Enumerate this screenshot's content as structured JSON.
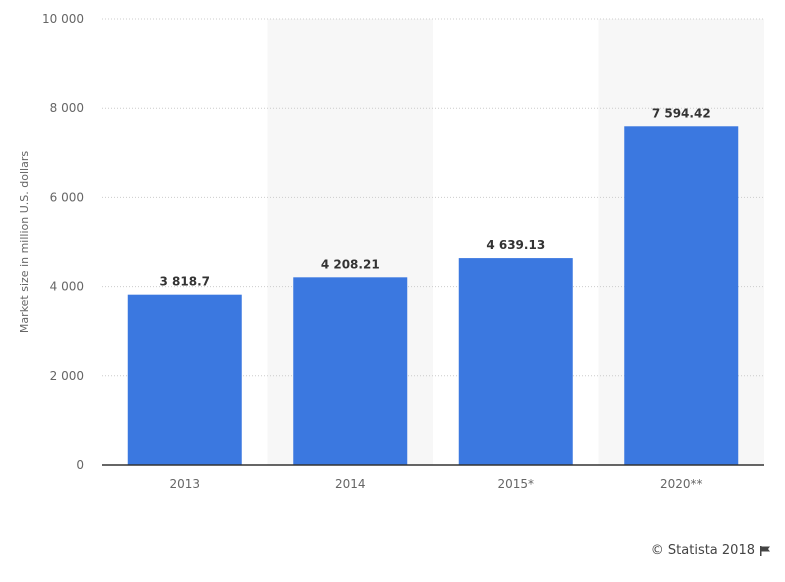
{
  "chart_data": {
    "type": "bar",
    "categories": [
      "2013",
      "2014",
      "2015*",
      "2020**"
    ],
    "values": [
      3818.7,
      4208.21,
      4639.13,
      7594.42
    ],
    "value_labels": [
      "3 818.7",
      "4 208.21",
      "4 639.13",
      "7 594.42"
    ],
    "title": "",
    "xlabel": "",
    "ylabel": "Market size in million U.S. dollars",
    "ylim": [
      0,
      10000
    ],
    "yticks": [
      0,
      2000,
      4000,
      6000,
      8000,
      10000
    ],
    "ytick_labels": [
      "0",
      "2 000",
      "4 000",
      "6 000",
      "8 000",
      "10 000"
    ],
    "grid": true,
    "bar_color": "#3b78e0",
    "band_color": "#f7f7f7"
  },
  "credit": {
    "text": "© Statista 2018",
    "icon": "flag-icon"
  }
}
